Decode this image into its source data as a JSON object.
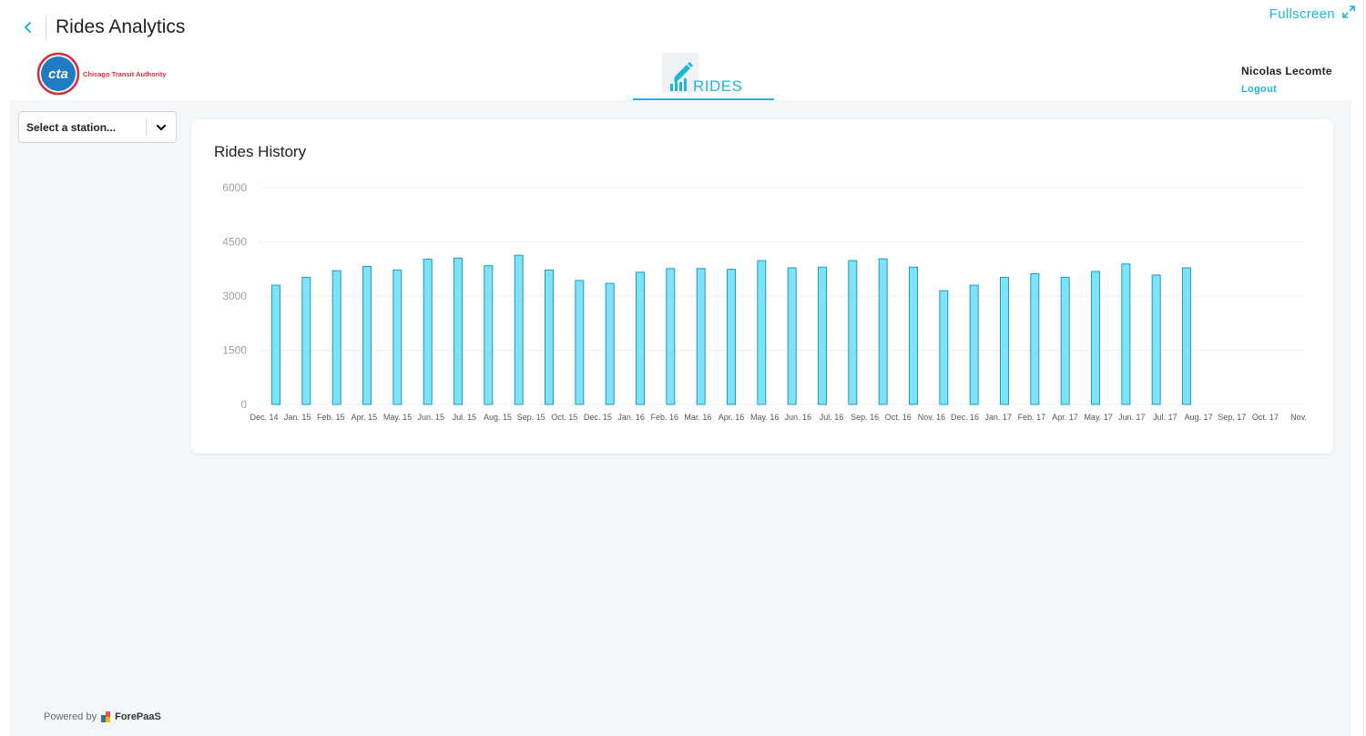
{
  "app": {
    "title": "Rides Analytics",
    "fullscreen_label": "Fullscreen",
    "accent_color": "#1fb6d6"
  },
  "header": {
    "logo": {
      "mark": "cta",
      "text": "Chicago Transit Authority"
    },
    "tab": {
      "label": "RIDES",
      "icon": "chart-edit-icon"
    },
    "user": {
      "name": "Nicolas Lecomte",
      "logout_label": "Logout"
    }
  },
  "filter": {
    "station_select": {
      "placeholder": "Select a station..."
    }
  },
  "chart_card": {
    "title": "Rides History"
  },
  "chart_data": {
    "type": "bar",
    "title": "Rides History",
    "xlabel": "",
    "ylabel": "",
    "ylim": [
      0,
      6000
    ],
    "yticks": [
      0,
      1500,
      3000,
      4500,
      6000
    ],
    "grid": true,
    "legend": "none",
    "bar_color": "#7ee3f7",
    "bar_edge_color": "#1a9cc0",
    "categories": [
      "Dec. 14",
      "Jan. 15",
      "Feb. 15",
      "Apr. 15",
      "May. 15",
      "Jun. 15",
      "Jul. 15",
      "Aug. 15",
      "Sep. 15",
      "Oct. 15",
      "Dec. 15",
      "Jan. 16",
      "Feb. 16",
      "Mar. 16",
      "Apr. 16",
      "May. 16",
      "Jun. 16",
      "Jul. 16",
      "Sep. 16",
      "Oct. 16",
      "Nov. 16",
      "Dec. 16",
      "Jan. 17",
      "Feb. 17",
      "Apr. 17",
      "May. 17",
      "Jun. 17",
      "Jul. 17",
      "Aug. 17",
      "Sep. 17",
      "Oct. 17",
      "Nov."
    ],
    "values": [
      3300,
      3520,
      3700,
      3820,
      3720,
      4020,
      4050,
      3840,
      4130,
      3720,
      3430,
      3350,
      3660,
      3760,
      3760,
      3740,
      3980,
      3780,
      3800,
      3980,
      4030,
      3800,
      3150,
      3300,
      3520,
      3620,
      3520,
      3680,
      3890,
      3580,
      3780
    ]
  },
  "footer": {
    "powered_by": "Powered by",
    "brand": "ForePaaS"
  }
}
